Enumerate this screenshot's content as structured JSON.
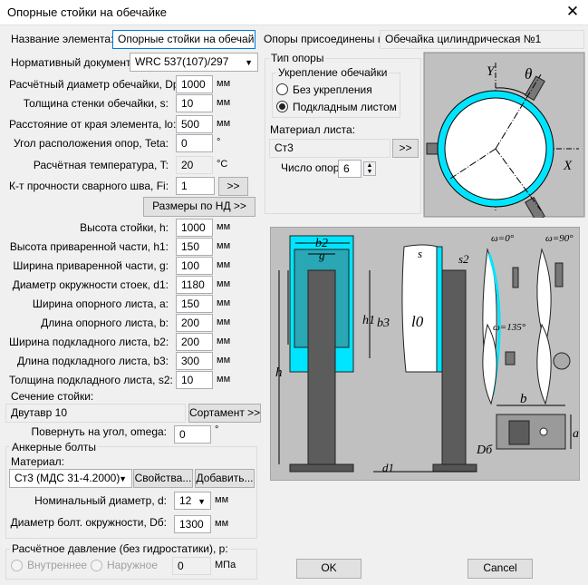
{
  "window": {
    "title": "Опорные стойки на обечайке"
  },
  "element": {
    "name_label": "Название элемента:",
    "name_value": "Опорные стойки на обечайке",
    "attached_label": "Опоры присоединены к:",
    "attached_value": "Обечайка цилиндрическая №1"
  },
  "norm": {
    "label": "Нормативный документ:",
    "value": "WRC 537(107)/297"
  },
  "fields": [
    {
      "label": "Расчётный диаметр обечайки, Dp:",
      "value": "1000",
      "unit": "мм"
    },
    {
      "label": "Толщина стенки обечайки, s:",
      "value": "10",
      "unit": "мм"
    },
    {
      "label": "Расстояние от края элемента, lo:",
      "value": "500",
      "unit": "мм"
    },
    {
      "label": "Угол расположения опор, Teta:",
      "value": "0",
      "unit": "°"
    },
    {
      "label": "Расчётная температура, T:",
      "value": "20",
      "unit": "°C"
    },
    {
      "label": "К-т прочности сварного шва, Fi:",
      "value": "1",
      "unit": ""
    }
  ],
  "buttons": {
    "fi_more": ">>",
    "nd_sizes": "Размеры по НД >>",
    "material_more": ">>",
    "sortament": "Сортамент >>",
    "properties": "Свойства...",
    "add": "Добавить...",
    "ok": "OK",
    "cancel": "Cancel"
  },
  "dims": [
    {
      "label": "Высота стойки, h:",
      "value": "1000",
      "unit": "мм"
    },
    {
      "label": "Высота приваренной части, h1:",
      "value": "150",
      "unit": "мм"
    },
    {
      "label": "Ширина приваренной части, g:",
      "value": "100",
      "unit": "мм"
    },
    {
      "label": "Диаметр окружности стоек, d1:",
      "value": "1180",
      "unit": "мм"
    },
    {
      "label": "Ширина опорного листа, a:",
      "value": "150",
      "unit": "мм"
    },
    {
      "label": "Длина опорного листа, b:",
      "value": "200",
      "unit": "мм"
    },
    {
      "label": "Ширина подкладного листа, b2:",
      "value": "200",
      "unit": "мм"
    },
    {
      "label": "Длина подкладного листа, b3:",
      "value": "300",
      "unit": "мм"
    },
    {
      "label": "Толщина подкладного листа, s2:",
      "value": "10",
      "unit": "мм"
    }
  ],
  "section": {
    "label": "Сечение стойки:",
    "value": "Двутавр 10",
    "rotate_label": "Повернуть на угол, omega:",
    "rotate_value": "0",
    "rotate_unit": "°"
  },
  "anchor": {
    "title": "Анкерные болты",
    "material_label": "Материал:",
    "material_value": "Ст3 (МДС 31-4.2000)",
    "dia_label": "Номинальный диаметр, d:",
    "dia_value": "12",
    "dia_unit": "мм",
    "circle_label": "Диаметр болт. окружности, Dб:",
    "circle_value": "1300",
    "circle_unit": "мм"
  },
  "pressure": {
    "title": "Расчётное давление (без гидростатики), р:",
    "inner": "Внутреннее",
    "outer": "Наружное",
    "value": "0",
    "unit": "МПа"
  },
  "support_type": {
    "title": "Тип опоры",
    "reinforce_title": "Укрепление обечайки",
    "opt_none": "Без укрепления",
    "opt_pad": "Подкладным листом",
    "sheet_material_label": "Материал листа:",
    "sheet_material_value": "Ст3",
    "count_label": "Число опор:",
    "count_value": "6"
  },
  "diagram_top": {
    "y": "Y",
    "x": "X",
    "theta": "θ"
  },
  "diagram_main": {
    "b2": "b2",
    "g": "g",
    "s": "s",
    "s2": "s2",
    "h1": "h1",
    "b3": "b3",
    "l0": "l0",
    "h": "h",
    "d1": "d1",
    "omega0": "ω=0°",
    "omega90": "ω=90°",
    "omega135": "ω=135°",
    "b": "b",
    "a": "a",
    "D6": "Dб"
  },
  "colors": {
    "cyan": "#19d3e0",
    "shell": "#00e5ff",
    "column": "#5c5c5c",
    "panel": "#c0c0c0"
  }
}
